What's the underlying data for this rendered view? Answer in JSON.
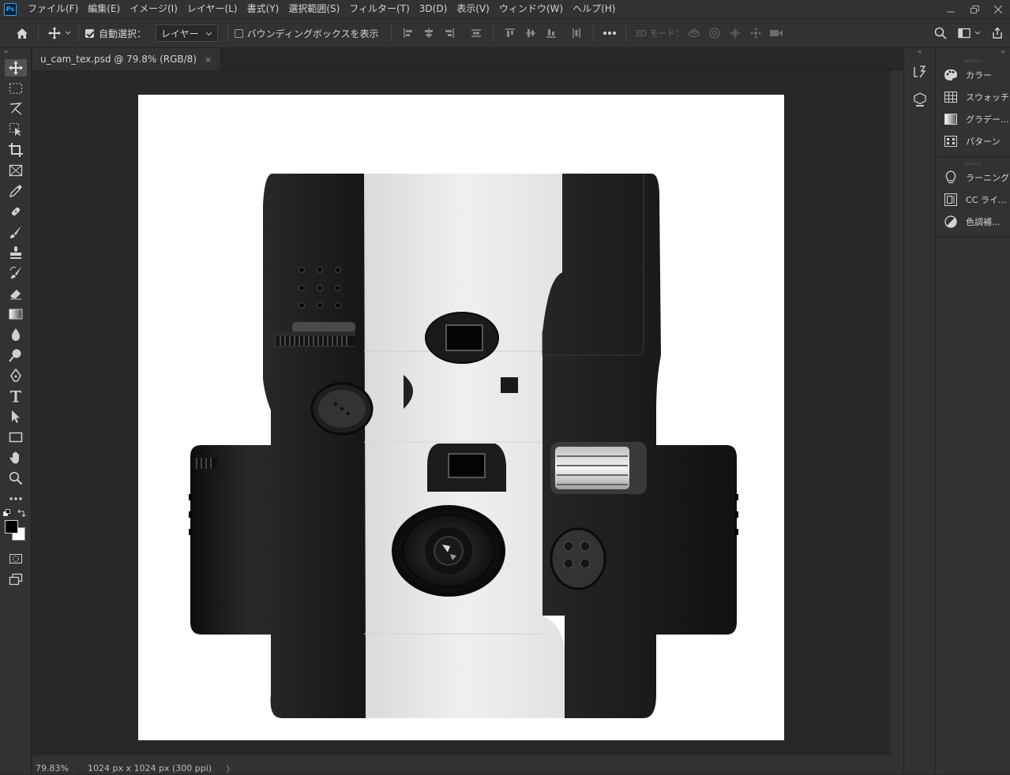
{
  "app": {
    "logo": "Ps",
    "menu": [
      "ファイル(F)",
      "編集(E)",
      "イメージ(I)",
      "レイヤー(L)",
      "書式(Y)",
      "選択範囲(S)",
      "フィルター(T)",
      "3D(D)",
      "表示(V)",
      "ウィンドウ(W)",
      "ヘルプ(H)"
    ],
    "window_controls": {
      "minimize": "minimize-icon",
      "restore": "restore-icon",
      "close": "close-icon"
    }
  },
  "options": {
    "auto_select_label": "自動選択：",
    "auto_select_checked": true,
    "target_select": "レイヤー",
    "bounding_box_label": "バウンディングボックスを表示",
    "bounding_box_checked": false,
    "mode_3d_label": "3D モード："
  },
  "document": {
    "tab_title": "u_cam_tex.psd @ 79.8% (RGB/8)",
    "close": "×"
  },
  "status": {
    "zoom": "79.83%",
    "info": "1024 px x 1024 px (300 ppi)",
    "arrow": "〉"
  },
  "panels": {
    "group1": [
      {
        "icon": "palette-icon",
        "label": "カラー"
      },
      {
        "icon": "grid-icon",
        "label": "スウォッチ"
      },
      {
        "icon": "gradient-icon",
        "label": "グラデー..."
      },
      {
        "icon": "pattern-icon",
        "label": "パターン"
      }
    ],
    "group2": [
      {
        "icon": "bulb-icon",
        "label": "ラーニング"
      },
      {
        "icon": "cc-library-icon",
        "label": "CC ライ..."
      },
      {
        "icon": "adjustment-icon",
        "label": "色調補..."
      }
    ]
  },
  "colors": {
    "foreground": "#000000",
    "background": "#ffffff"
  }
}
